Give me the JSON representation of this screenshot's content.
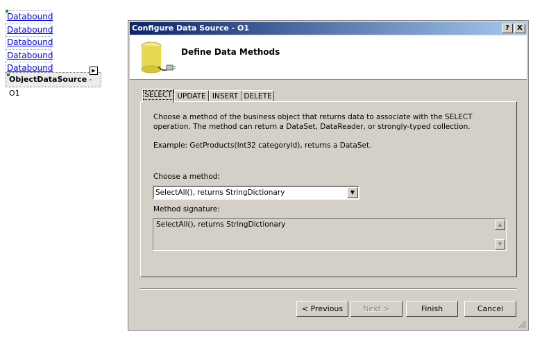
{
  "designer": {
    "databound_links": [
      "Databound",
      "Databound",
      "Databound",
      "Databound",
      "Databound"
    ],
    "ods_name": "ObjectDataSource",
    "ods_id": " - O1"
  },
  "dialog": {
    "title": "Configure Data Source - O1",
    "help_label": "?",
    "close_label": "X",
    "header_title": "Define Data Methods",
    "tabs": [
      {
        "label": "SELECT",
        "active": true
      },
      {
        "label": "UPDATE",
        "active": false
      },
      {
        "label": "INSERT",
        "active": false
      },
      {
        "label": "DELETE",
        "active": false
      }
    ],
    "description": "Choose a method of the business object that returns data to associate with the SELECT operation. The method can return a DataSet, DataReader, or strongly-typed collection.",
    "example": "Example: GetProducts(Int32 categoryId), returns a DataSet.",
    "choose_label": "Choose a method:",
    "method_selected": "SelectAll(), returns StringDictionary",
    "signature_label": "Method signature:",
    "signature_value": "SelectAll(), returns StringDictionary",
    "buttons": {
      "previous": "< Previous",
      "next": "Next >",
      "finish": "Finish",
      "cancel": "Cancel"
    }
  }
}
